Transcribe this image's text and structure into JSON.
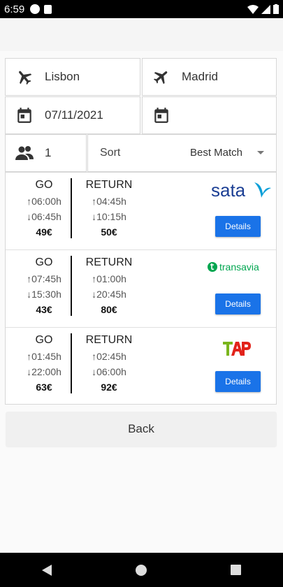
{
  "status_bar": {
    "time": "6:59"
  },
  "search": {
    "origin": "Lisbon",
    "destination": "Madrid",
    "depart_date": "07/11/2021",
    "return_date": "",
    "passengers": "1",
    "sort_label": "Sort",
    "sort_value": "Best Match"
  },
  "results": [
    {
      "airline": "sata",
      "go_label": "GO",
      "return_label": "RETURN",
      "go_dep": "06:00h",
      "go_arr": "06:45h",
      "go_price": "49€",
      "ret_dep": "04:45h",
      "ret_arr": "10:15h",
      "ret_price": "50€",
      "details_label": "Details"
    },
    {
      "airline": "transavia",
      "go_label": "GO",
      "return_label": "RETURN",
      "go_dep": "07:45h",
      "go_arr": "15:30h",
      "go_price": "43€",
      "ret_dep": "01:00h",
      "ret_arr": "20:45h",
      "ret_price": "80€",
      "details_label": "Details"
    },
    {
      "airline": "TAP",
      "go_label": "GO",
      "return_label": "RETURN",
      "go_dep": "01:45h",
      "go_arr": "22:00h",
      "go_price": "63€",
      "ret_dep": "02:45h",
      "ret_arr": "06:00h",
      "ret_price": "92€",
      "details_label": "Details"
    }
  ],
  "arrows": {
    "up": "↑",
    "down": "↓"
  },
  "back_label": "Back",
  "colors": {
    "primary_button": "#1a73e8",
    "sata": "#1c3f94",
    "transavia": "#00a650",
    "tap_green": "#7ab51d",
    "tap_red": "#e2231a"
  }
}
